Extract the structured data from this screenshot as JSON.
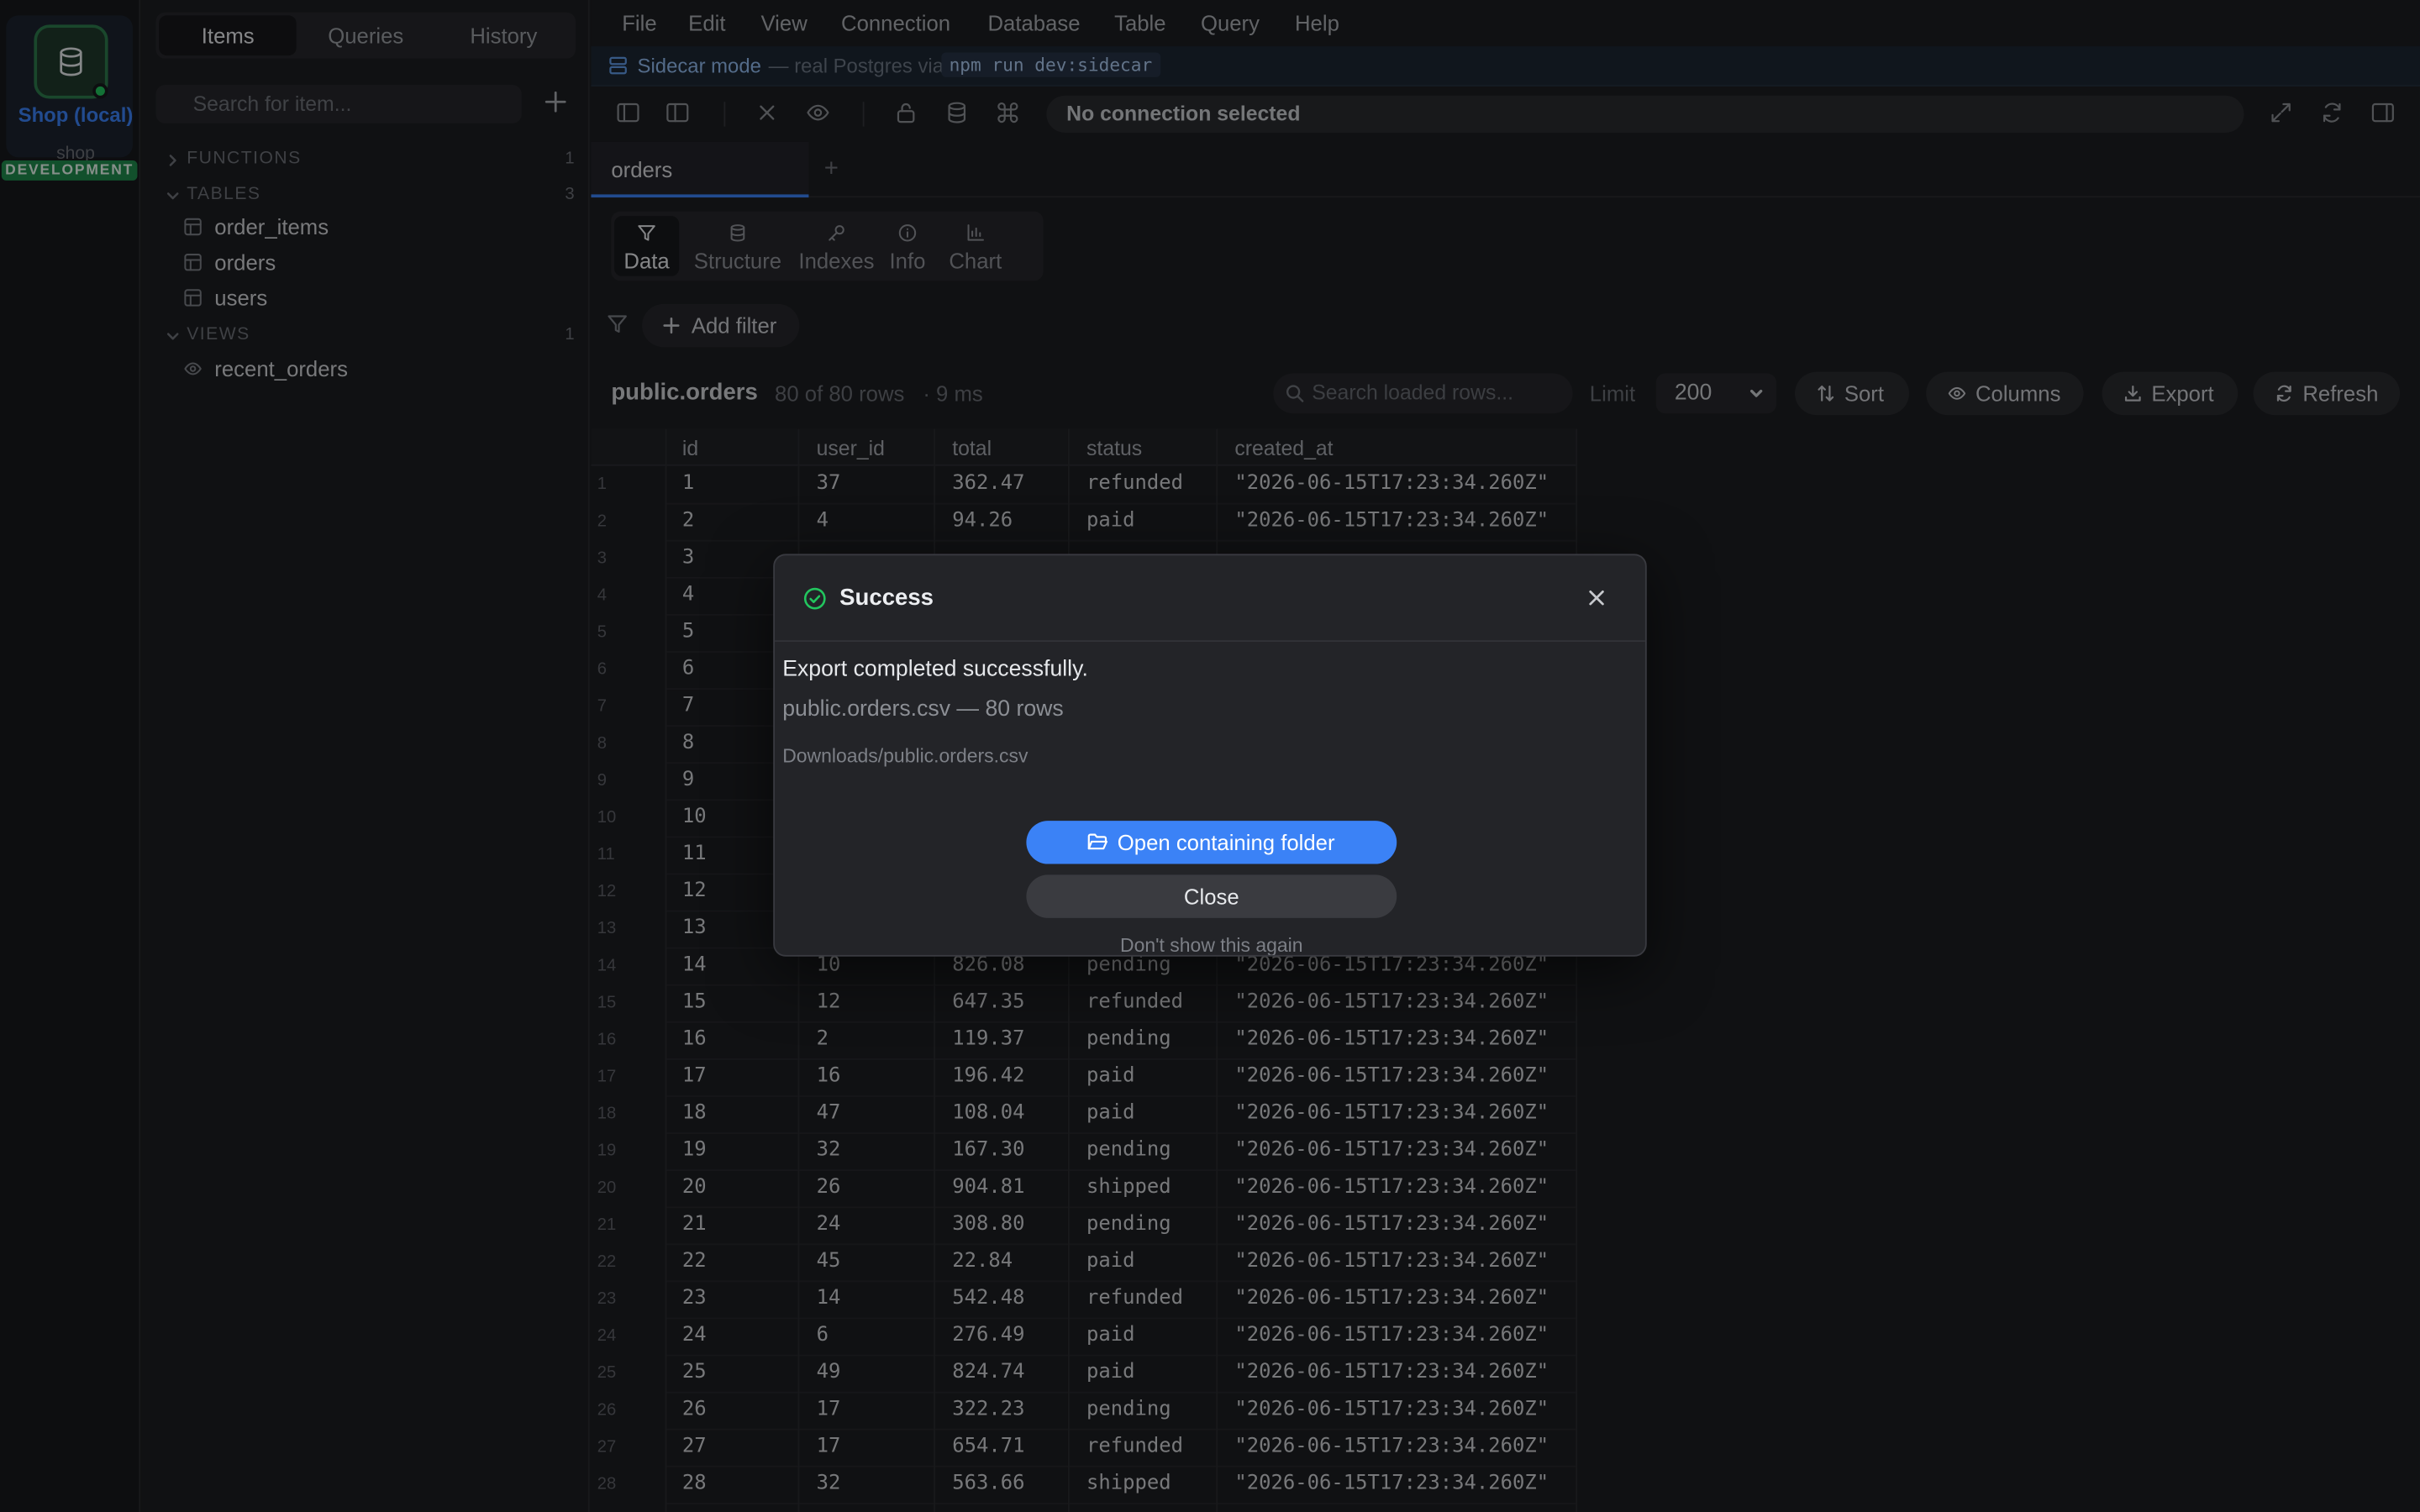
{
  "connection": {
    "name": "Shop (local)",
    "database": "shop",
    "environment": "DEVELOPMENT",
    "status_color": "#22c55e",
    "name_color": "#3b82f6",
    "env_color": "#1f8a4c"
  },
  "sidebar": {
    "tabs": [
      {
        "label": "Items",
        "active": true
      },
      {
        "label": "Queries",
        "active": false
      },
      {
        "label": "History",
        "active": false
      }
    ],
    "search_placeholder": "Search for item...",
    "groups": {
      "functions": {
        "label": "FUNCTIONS",
        "count": "1",
        "expanded": false
      },
      "tables": {
        "label": "TABLES",
        "count": "3",
        "expanded": true,
        "items": [
          "order_items",
          "orders",
          "users"
        ]
      },
      "views": {
        "label": "VIEWS",
        "count": "1",
        "expanded": true,
        "items": [
          "recent_orders"
        ]
      }
    }
  },
  "menubar": [
    "File",
    "Edit",
    "View",
    "Connection",
    "Database",
    "Table",
    "Query",
    "Help"
  ],
  "sidecar": {
    "label": "Sidecar mode",
    "note": "— real Postgres via",
    "command": "npm run dev:sidecar"
  },
  "toolbar": {
    "connection_status": "No connection selected",
    "icons": [
      "sidebar-left-icon",
      "sidebar-panel-icon",
      "close-icon",
      "eye-icon",
      "lock-icon",
      "database-icon",
      "command-icon",
      "expand-icon",
      "refresh-icon",
      "panel-right-icon"
    ]
  },
  "tabs": {
    "open": [
      {
        "label": "orders",
        "active": true
      }
    ],
    "add_label": "+"
  },
  "subtabs": [
    {
      "label": "Data",
      "icon": "filter-icon",
      "active": true
    },
    {
      "label": "Structure",
      "icon": "database-icon",
      "active": false
    },
    {
      "label": "Indexes",
      "icon": "key-icon",
      "active": false
    },
    {
      "label": "Info",
      "icon": "info-icon",
      "active": false
    },
    {
      "label": "Chart",
      "icon": "bar-chart-icon",
      "active": false
    }
  ],
  "filter": {
    "add_label": "Add filter"
  },
  "results": {
    "table": "public.orders",
    "rows": "80 of 80 rows",
    "time": "· 9 ms",
    "search_placeholder": "Search loaded rows...",
    "limit_label": "Limit",
    "limit_value": "200",
    "sort_label": "Sort",
    "columns_label": "Columns",
    "export_label": "Export",
    "refresh_label": "Refresh"
  },
  "grid": {
    "columns": [
      "id",
      "user_id",
      "total",
      "status",
      "created_at"
    ],
    "rows": [
      [
        "1",
        "37",
        "362.47",
        "refunded",
        "\"2026-06-15T17:23:34.260Z\""
      ],
      [
        "2",
        "4",
        "94.26",
        "paid",
        "\"2026-06-15T17:23:34.260Z\""
      ],
      [
        "3",
        "",
        "",
        "",
        ""
      ],
      [
        "4",
        "",
        "",
        "",
        ""
      ],
      [
        "5",
        "",
        "",
        "",
        ""
      ],
      [
        "6",
        "",
        "",
        "",
        ""
      ],
      [
        "7",
        "",
        "",
        "",
        ""
      ],
      [
        "8",
        "",
        "",
        "",
        ""
      ],
      [
        "9",
        "",
        "",
        "",
        ""
      ],
      [
        "10",
        "",
        "",
        "",
        ""
      ],
      [
        "11",
        "",
        "",
        "",
        ""
      ],
      [
        "12",
        "",
        "",
        "",
        ""
      ],
      [
        "13",
        "",
        "",
        "",
        ""
      ],
      [
        "14",
        "10",
        "826.08",
        "pending",
        "\"2026-06-15T17:23:34.260Z\""
      ],
      [
        "15",
        "12",
        "647.35",
        "refunded",
        "\"2026-06-15T17:23:34.260Z\""
      ],
      [
        "16",
        "2",
        "119.37",
        "pending",
        "\"2026-06-15T17:23:34.260Z\""
      ],
      [
        "17",
        "16",
        "196.42",
        "paid",
        "\"2026-06-15T17:23:34.260Z\""
      ],
      [
        "18",
        "47",
        "108.04",
        "paid",
        "\"2026-06-15T17:23:34.260Z\""
      ],
      [
        "19",
        "32",
        "167.30",
        "pending",
        "\"2026-06-15T17:23:34.260Z\""
      ],
      [
        "20",
        "26",
        "904.81",
        "shipped",
        "\"2026-06-15T17:23:34.260Z\""
      ],
      [
        "21",
        "24",
        "308.80",
        "pending",
        "\"2026-06-15T17:23:34.260Z\""
      ],
      [
        "22",
        "45",
        "22.84",
        "paid",
        "\"2026-06-15T17:23:34.260Z\""
      ],
      [
        "23",
        "14",
        "542.48",
        "refunded",
        "\"2026-06-15T17:23:34.260Z\""
      ],
      [
        "24",
        "6",
        "276.49",
        "paid",
        "\"2026-06-15T17:23:34.260Z\""
      ],
      [
        "25",
        "49",
        "824.74",
        "paid",
        "\"2026-06-15T17:23:34.260Z\""
      ],
      [
        "26",
        "17",
        "322.23",
        "pending",
        "\"2026-06-15T17:23:34.260Z\""
      ],
      [
        "27",
        "17",
        "654.71",
        "refunded",
        "\"2026-06-15T17:23:34.260Z\""
      ],
      [
        "28",
        "32",
        "563.66",
        "shipped",
        "\"2026-06-15T17:23:34.260Z\""
      ]
    ]
  },
  "dialog": {
    "title": "Success",
    "message": "Export completed successfully.",
    "file_info": "public.orders.csv — 80 rows",
    "path": "Downloads/public.orders.csv",
    "primary_label": "Open containing folder",
    "secondary_label": "Close",
    "dismiss_label": "Don't show this again",
    "accent_color": "#3b82f6",
    "success_color": "#22c55e"
  }
}
